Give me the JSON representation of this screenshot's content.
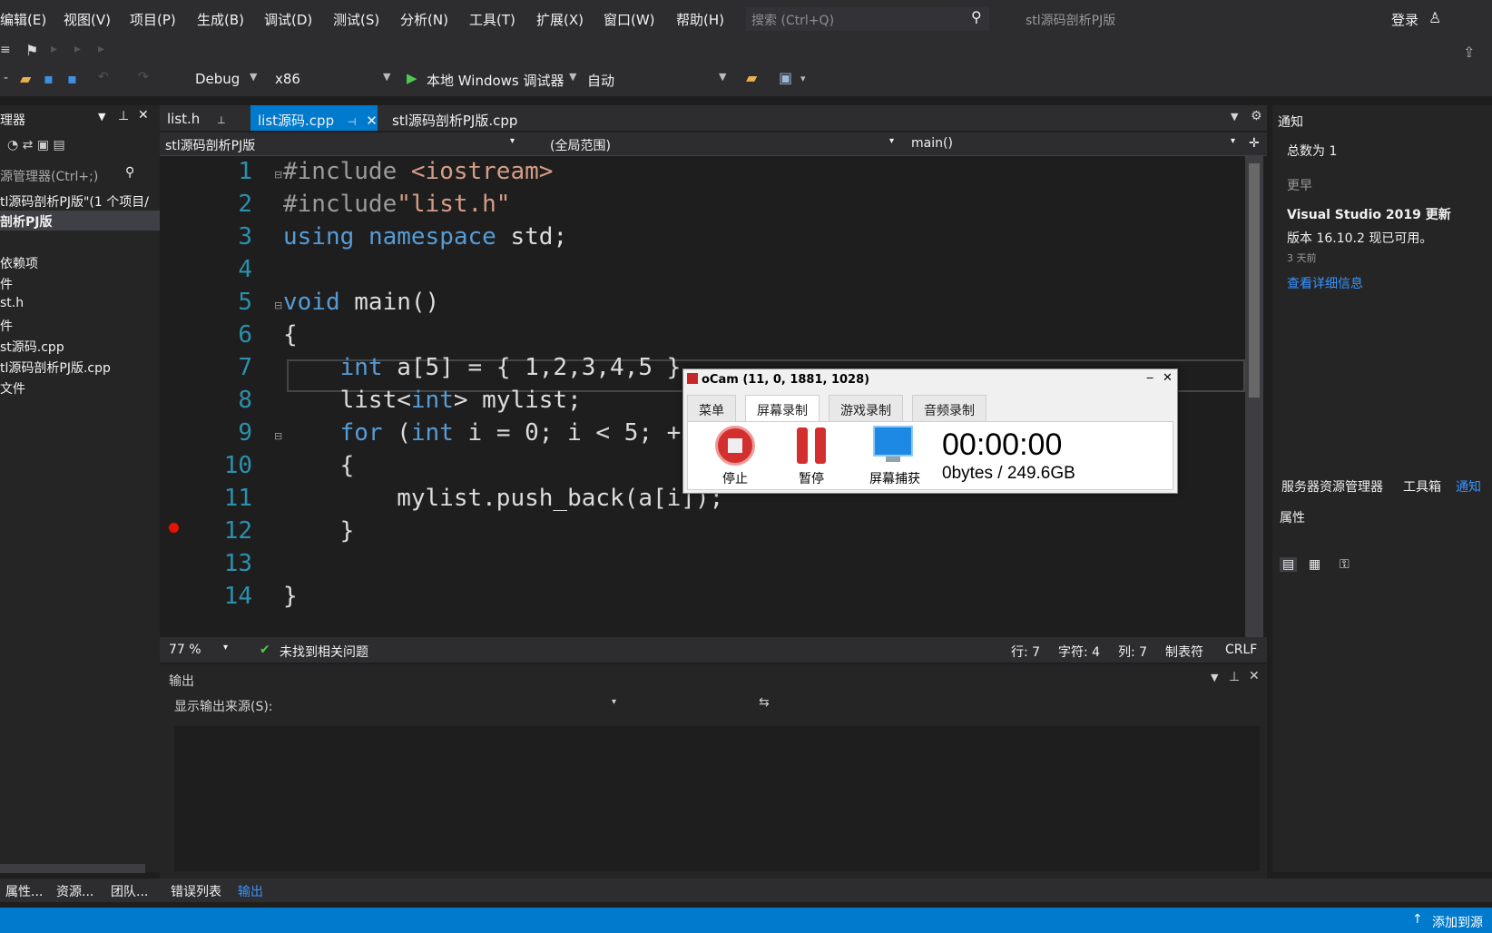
{
  "menu": {
    "items": [
      "编辑(E)",
      "视图(V)",
      "项目(P)",
      "生成(B)",
      "调试(D)",
      "测试(S)",
      "分析(N)",
      "工具(T)",
      "扩展(X)",
      "窗口(W)",
      "帮助(H)"
    ],
    "search_placeholder": "搜索 (Ctrl+Q)",
    "window_title": "stl源码剖析PJ版",
    "login": "登录"
  },
  "toolbar": {
    "config": "Debug",
    "platform": "x86",
    "debugger": "本地 Windows 调试器",
    "auto": "自动"
  },
  "solution_explorer": {
    "title": "理器",
    "search": "源管理器(Ctrl+;)",
    "items": [
      "tl源码剖析PJ版\"(1 个项目/",
      "剖析PJ版",
      "依赖项",
      "件",
      "st.h",
      "件",
      "st源码.cpp",
      "tl源码剖析PJ版.cpp",
      "文件"
    ]
  },
  "tabs": {
    "tab1": "list.h",
    "tab2": "list源码.cpp",
    "tab3": "stl源码剖析PJ版.cpp"
  },
  "navbar": {
    "project": "stl源码剖析PJ版",
    "scope": "(全局范围)",
    "member": "main()"
  },
  "code": {
    "line_numbers": [
      "1",
      "2",
      "3",
      "4",
      "5",
      "6",
      "7",
      "8",
      "9",
      "10",
      "11",
      "12",
      "13",
      "14"
    ]
  },
  "editor_status": {
    "zoom": "77 %",
    "issues": "未找到相关问题",
    "line": "行: 7",
    "char": "字符: 4",
    "col": "列: 7",
    "tabs": "制表符",
    "eol": "CRLF"
  },
  "output": {
    "title": "输出",
    "source_label": "显示输出来源(S):"
  },
  "notifications": {
    "title": "通知",
    "count": "总数为 1",
    "section": "更早",
    "headline": "Visual Studio 2019 更新",
    "detail": "版本 16.10.2 现已可用。",
    "age": "3 天前",
    "link": "查看详细信息"
  },
  "right_tabs": {
    "server": "服务器资源管理器",
    "toolbox": "工具箱",
    "notify": "通知",
    "properties": "属性"
  },
  "bottom_tabs": {
    "props": "属性...",
    "res": "资源...",
    "team": "团队...",
    "errors": "错误列表",
    "output": "输出"
  },
  "statusbar": {
    "add_source": "添加到源"
  },
  "ocam": {
    "title": "oCam (11, 0, 1881, 1028)",
    "tab_menu": "菜单",
    "tab_screen": "屏幕录制",
    "tab_game": "游戏录制",
    "tab_audio": "音频录制",
    "stop": "停止",
    "pause": "暂停",
    "capture": "屏幕捕获",
    "time": "00:00:00",
    "size": "0bytes / 249.6GB"
  },
  "colors": {
    "accent": "#007acc",
    "editor_bg": "#1e1e1e",
    "keyword": "#569cd6",
    "line_number": "#2b91af"
  }
}
